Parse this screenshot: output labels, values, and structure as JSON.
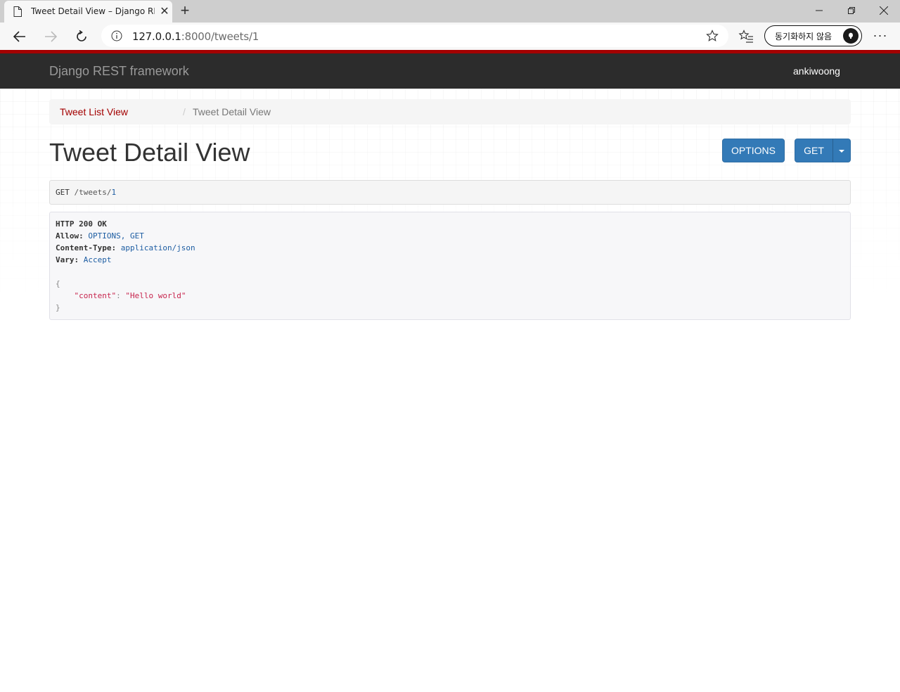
{
  "browser": {
    "tab_title": "Tweet Detail View – Django REST framework",
    "url_host": "127.0.0.1",
    "url_rest": ":8000/tweets/1",
    "sync_label": "동기화하지 않음"
  },
  "navbar": {
    "brand": "Django REST framework",
    "user": "ankiwoong"
  },
  "breadcrumb": {
    "items": [
      {
        "label": "Tweet List View"
      },
      {
        "label": "Tweet Detail View"
      }
    ],
    "separator": "/"
  },
  "page": {
    "title": "Tweet Detail View",
    "options_label": "OPTIONS",
    "get_label": "GET"
  },
  "request": {
    "method": "GET",
    "path": "/tweets/",
    "id": "1"
  },
  "response": {
    "status": "HTTP 200 OK",
    "headers": [
      {
        "key": "Allow:",
        "value": "OPTIONS, GET"
      },
      {
        "key": "Content-Type:",
        "value": "application/json"
      },
      {
        "key": "Vary:",
        "value": "Accept"
      }
    ],
    "json_open": "{",
    "json_close": "}",
    "json_key": "\"content\"",
    "json_colon": ": ",
    "json_value": "\"Hello world\""
  },
  "colors": {
    "accent_red": "#a30000",
    "button_blue": "#337ab7",
    "navbar_dark": "#2c2c2c"
  }
}
